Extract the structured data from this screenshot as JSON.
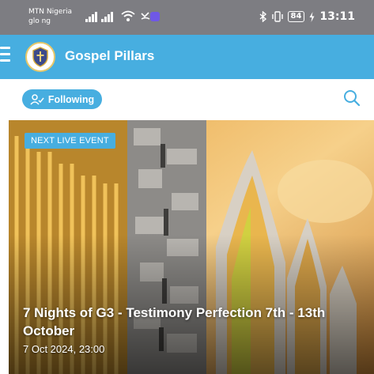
{
  "status_bar": {
    "carrier_primary": "MTN Nigeria",
    "carrier_secondary": "glo ng",
    "bluetooth_icon": "bluetooth-icon",
    "vibrate_icon": "vibrate-icon",
    "battery_level": "84",
    "charging_icon": "bolt-icon",
    "time": "13:11"
  },
  "app_bar": {
    "menu_icon": "menu-icon",
    "title": "Gospel Pillars",
    "color": "#47aee0"
  },
  "toolbar": {
    "follow_label": "Following",
    "search_icon": "search-icon"
  },
  "event": {
    "badge": "NEXT LIVE EVENT",
    "title": "7 Nights of G3 - Testimony Perfection 7th - 13th October",
    "date": "7 Oct 2024, 23:00"
  }
}
